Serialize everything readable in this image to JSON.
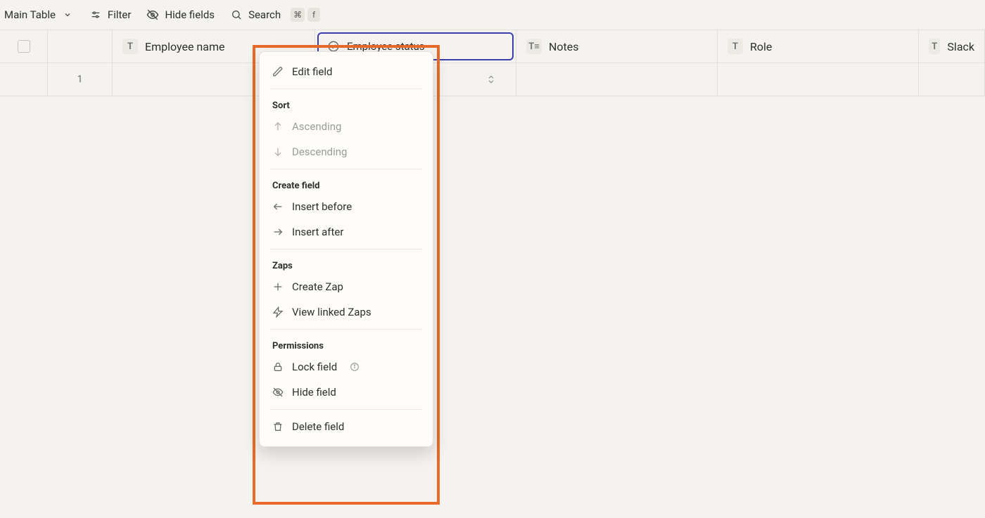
{
  "toolbar": {
    "view_name": "Main Table",
    "filter_label": "Filter",
    "hide_fields_label": "Hide fields",
    "search_label": "Search",
    "search_kbd1": "⌘",
    "search_kbd2": "f"
  },
  "columns": {
    "name": {
      "label": "Employee name",
      "type_abbr": "T"
    },
    "status": {
      "label": "Employee status",
      "type_abbr": "✓"
    },
    "notes": {
      "label": "Notes",
      "type_abbr": "T≡"
    },
    "role": {
      "label": "Role",
      "type_abbr": "T"
    },
    "slack": {
      "label": "Slack",
      "type_abbr": "T"
    }
  },
  "rows": [
    {
      "num": "1",
      "name": "",
      "status": "",
      "notes": "",
      "role": "",
      "slack": ""
    }
  ],
  "menu": {
    "edit_field": "Edit field",
    "sort_header": "Sort",
    "ascending": "Ascending",
    "descending": "Descending",
    "create_header": "Create field",
    "insert_before": "Insert before",
    "insert_after": "Insert after",
    "zaps_header": "Zaps",
    "create_zap": "Create Zap",
    "view_zaps": "View linked Zaps",
    "permissions_header": "Permissions",
    "lock_field": "Lock field",
    "hide_field": "Hide field",
    "delete_field": "Delete field"
  }
}
